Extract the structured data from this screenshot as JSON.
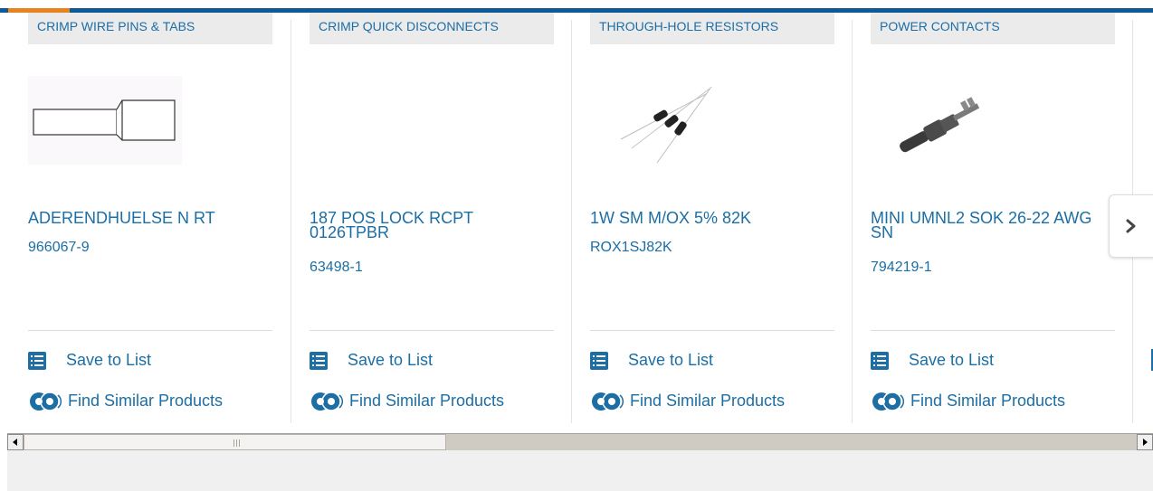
{
  "colors": {
    "accent_blue": "#1c6ea4",
    "top_bar": "#0e5a96",
    "top_bar_accent": "#e8831e"
  },
  "cards": [
    {
      "category": "CRIMP WIRE PINS & TABS",
      "name": "ADERENDHUELSE N RT",
      "part_number": "966067-9",
      "image": "ferrule-drawing",
      "save_label": "Save to List",
      "similar_label": "Find Similar Products"
    },
    {
      "category": "CRIMP QUICK DISCONNECTS",
      "name": "187 POS LOCK RCPT 0126TPBR",
      "part_number": "63498-1",
      "image": "none",
      "save_label": "Save to List",
      "similar_label": "Find Similar Products"
    },
    {
      "category": "THROUGH-HOLE RESISTORS",
      "name": "1W SM M/OX 5% 82K",
      "part_number": "ROX1SJ82K",
      "image": "resistors-photo",
      "save_label": "Save to List",
      "similar_label": "Find Similar Products"
    },
    {
      "category": "POWER CONTACTS",
      "name": "MINI UMNL2 SOK 26-22 AWG SN",
      "part_number": "794219-1",
      "image": "power-contact-photo",
      "save_label": "Save to List",
      "similar_label": "Find Similar Products"
    }
  ],
  "next_button": {
    "icon": "chevron-right-icon"
  },
  "scrollbar": {
    "left_arrow": "scroll-left-arrow-icon",
    "right_arrow": "scroll-right-arrow-icon"
  }
}
